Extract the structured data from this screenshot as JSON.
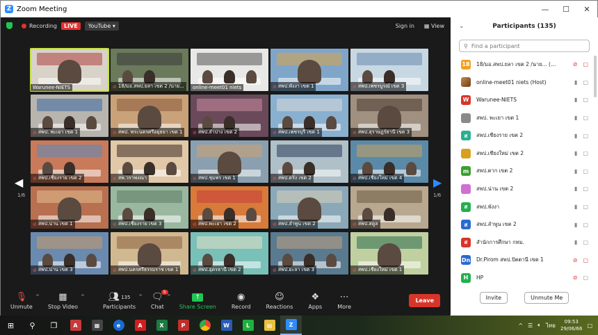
{
  "window": {
    "title": "Zoom Meeting"
  },
  "topbar": {
    "recording": "Recording",
    "live": "LIVE",
    "youtube": "YouTube",
    "signin": "Sign in",
    "view": "View"
  },
  "grid": {
    "page_left": "1/6",
    "page_right": "1/6",
    "tiles": [
      {
        "label": "Warunee-NIETS",
        "muted": false,
        "bg": "#d8d2c8",
        "accent": "#b04040",
        "active": true
      },
      {
        "label": "18/มอ.สพป.ยลา เขต 2 /นาย...",
        "muted": true,
        "bg": "#6a7a5a",
        "accent": "#3a3a3a"
      },
      {
        "label": "online-meet01 niets",
        "muted": false,
        "bg": "#e8e8e6",
        "accent": "#555555"
      },
      {
        "label": "สพป.พังงา เขต 1",
        "muted": true,
        "bg": "#7fa6c8",
        "accent": "#d8a24a"
      },
      {
        "label": "สพป.เพชรบูรณ์ เขต 3",
        "muted": true,
        "bg": "#c8d8e2",
        "accent": "#6a8ab0"
      },
      {
        "label": "สพป. พะเยา เขต 1",
        "muted": true,
        "bg": "#b8b4ae",
        "accent": "#3a6aa0"
      },
      {
        "label": "สพป. พระนครศรีอยุธยา เขต 1",
        "muted": true,
        "bg": "#caa27a",
        "accent": "#8a5a3a"
      },
      {
        "label": "สพป.ลำปาง เขต 2",
        "muted": true,
        "bg": "#6a4a5a",
        "accent": "#c88aa0"
      },
      {
        "label": "สพป.เพชรบุรี เขต 1",
        "muted": true,
        "bg": "#8ab0d0",
        "accent": "#d8d8d8"
      },
      {
        "label": "สพป.สุราษฎร์ธานี เขต 3",
        "muted": true,
        "bg": "#a09080",
        "accent": "#4a3a30"
      },
      {
        "label": "สพป.เชียงราย เขต 2",
        "muted": true,
        "bg": "#c87a5a",
        "accent": "#5a8ac0"
      },
      {
        "label": "สพ.วราพงณา",
        "muted": true,
        "bg": "#e0c8a8",
        "accent": "#3a2a20"
      },
      {
        "label": "สพป.ชุมพร เขต 1",
        "muted": true,
        "bg": "#8aa0b0",
        "accent": "#d0a070"
      },
      {
        "label": "สพป.ตรัง เขต 2",
        "muted": true,
        "bg": "#b0c0c8",
        "accent": "#2a3a5a"
      },
      {
        "label": "สพป.เชียงใหม่ เขต 4",
        "muted": true,
        "bg": "#5a8aa8",
        "accent": "#c8a060"
      },
      {
        "label": "สพป.น่าน เขต 1",
        "muted": true,
        "bg": "#b87050",
        "accent": "#e0c090"
      },
      {
        "label": "สพป.เชียงราย เขต 3",
        "muted": true,
        "bg": "#9ab8a0",
        "accent": "#5a7a60"
      },
      {
        "label": "สพป.พะเยา เขต 2",
        "muted": true,
        "bg": "#d87a3a",
        "accent": "#c83a3a"
      },
      {
        "label": "สพป.ลำพูน เขต 2",
        "muted": true,
        "bg": "#8aa8b8",
        "accent": "#d8d0b8"
      },
      {
        "label": "สพป.สตูล",
        "muted": true,
        "bg": "#b8a890",
        "accent": "#6a5a40"
      },
      {
        "label": "สพป.น่าน เขต 3",
        "muted": true,
        "bg": "#6a8ab0",
        "accent": "#c89a6a"
      },
      {
        "label": "สพป.นครศรีธรรมราช เขต 1",
        "muted": true,
        "bg": "#d0b890",
        "accent": "#8a6040"
      },
      {
        "label": "สพป.อุดรธานี เขต 2",
        "muted": true,
        "bg": "#78c0b8",
        "accent": "#e8e0c8"
      },
      {
        "label": "สพป.ยะลา เขต 3",
        "muted": true,
        "bg": "#5a7a90",
        "accent": "#c0a080"
      },
      {
        "label": "สพป.เชียงใหม่ เขต 1",
        "muted": true,
        "bg": "#c0d0a0",
        "accent": "#2a6a4a"
      }
    ]
  },
  "toolbar": {
    "unmute": "Unmute",
    "stop_video": "Stop Video",
    "participants": "Participants",
    "participants_count": "135",
    "chat": "Chat",
    "chat_badge": "5",
    "share_screen": "Share Screen",
    "record": "Record",
    "reactions": "Reactions",
    "apps": "Apps",
    "more": "More",
    "leave": "Leave"
  },
  "panel": {
    "title": "Participants (135)",
    "search_placeholder": "Find a participant",
    "invite": "Invite",
    "unmute_me": "Unmute Me",
    "participants": [
      {
        "initial": "18",
        "name": "18/มอ.สพป.ยลา เขต 2 /นาย... (Me)",
        "color": "#f0a020",
        "mic_off": true,
        "video_off": true
      },
      {
        "initial": "",
        "name": "online-meet01 niets (Host)",
        "color": "image",
        "mic_off": false,
        "video_off": false
      },
      {
        "initial": "W",
        "name": "Warunee-NIETS",
        "color": "#d8352a",
        "mic_off": false,
        "video_off": false
      },
      {
        "initial": "",
        "name": "สพป. พะเยา เขต 1",
        "color": "#8a8a8a",
        "mic_off": false,
        "video_off": false
      },
      {
        "initial": "ส",
        "name": "สพป.เชียงราย เขต 2",
        "color": "#2ab090",
        "mic_off": false,
        "video_off": false
      },
      {
        "initial": "",
        "name": "สพป.เชียงใหม่ เขต 2",
        "color": "#d8a020",
        "mic_off": false,
        "video_off": false
      },
      {
        "initial": "m",
        "name": "สพป.ตาก เขต 2",
        "color": "#3aa030",
        "mic_off": false,
        "video_off": false
      },
      {
        "initial": "",
        "name": "สพป.น่าน เขต 2",
        "color": "#d070d0",
        "mic_off": false,
        "video_off": false
      },
      {
        "initial": "ส",
        "name": "สพป.พังงา",
        "color": "#23b050",
        "mic_off": false,
        "video_off": false
      },
      {
        "initial": "ส",
        "name": "สพป.ลำพูน เขต 2",
        "color": "#2a6ad0",
        "mic_off": false,
        "video_off": false
      },
      {
        "initial": "ส",
        "name": "สำนักการศึกษา กทม.",
        "color": "#d8352a",
        "mic_off": false,
        "video_off": false
      },
      {
        "initial": "Dn",
        "name": "Dr.Pirom สพป.ปัตตานี เขต 1",
        "color": "#2a6ad0",
        "mic_off": true,
        "video_off": true
      },
      {
        "initial": "H",
        "name": "HP",
        "color": "#23b050",
        "mic_off": true,
        "video_off": false
      }
    ]
  },
  "taskbar": {
    "time": "09:53",
    "date": "29/06/66",
    "lang": "ไทย"
  }
}
